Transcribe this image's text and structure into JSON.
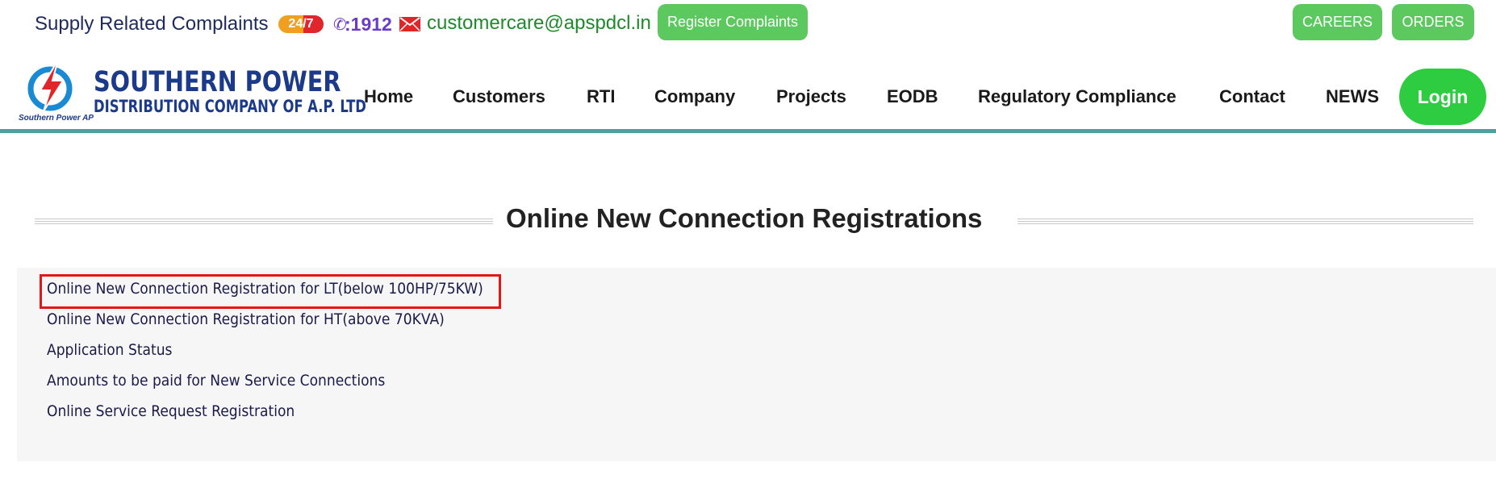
{
  "topbar": {
    "supply_text": "Supply Related Complaints",
    "badge_247": "24/7",
    "phone_number": ":1912",
    "email": "customercare@apspdcl.in",
    "register_btn": "Register Complaints",
    "careers_btn": "CAREERS",
    "orders_btn": "ORDERS"
  },
  "logo": {
    "line1": "SOUTHERN POWER",
    "line2": "DISTRIBUTION COMPANY OF A.P. LTD",
    "tagline": "Southern Power AP"
  },
  "nav": {
    "items": [
      "Home",
      "Customers",
      "RTI",
      "Company",
      "Projects",
      "EODB",
      "Regulatory Compliance",
      "Contact",
      "NEWS"
    ],
    "login": "Login"
  },
  "main": {
    "title": "Online New Connection Registrations",
    "links": [
      "Online New Connection Registration for LT(below 100HP/75KW)",
      "Online New Connection Registration for HT(above 70KVA)",
      "Application Status",
      "Amounts to be paid for New Service Connections",
      "Online Service Request Registration"
    ]
  },
  "colors": {
    "accent_green": "#5cc95e",
    "login_green": "#2ecc40",
    "nav_rule": "#4fa09e",
    "highlight_red": "#e01818"
  }
}
